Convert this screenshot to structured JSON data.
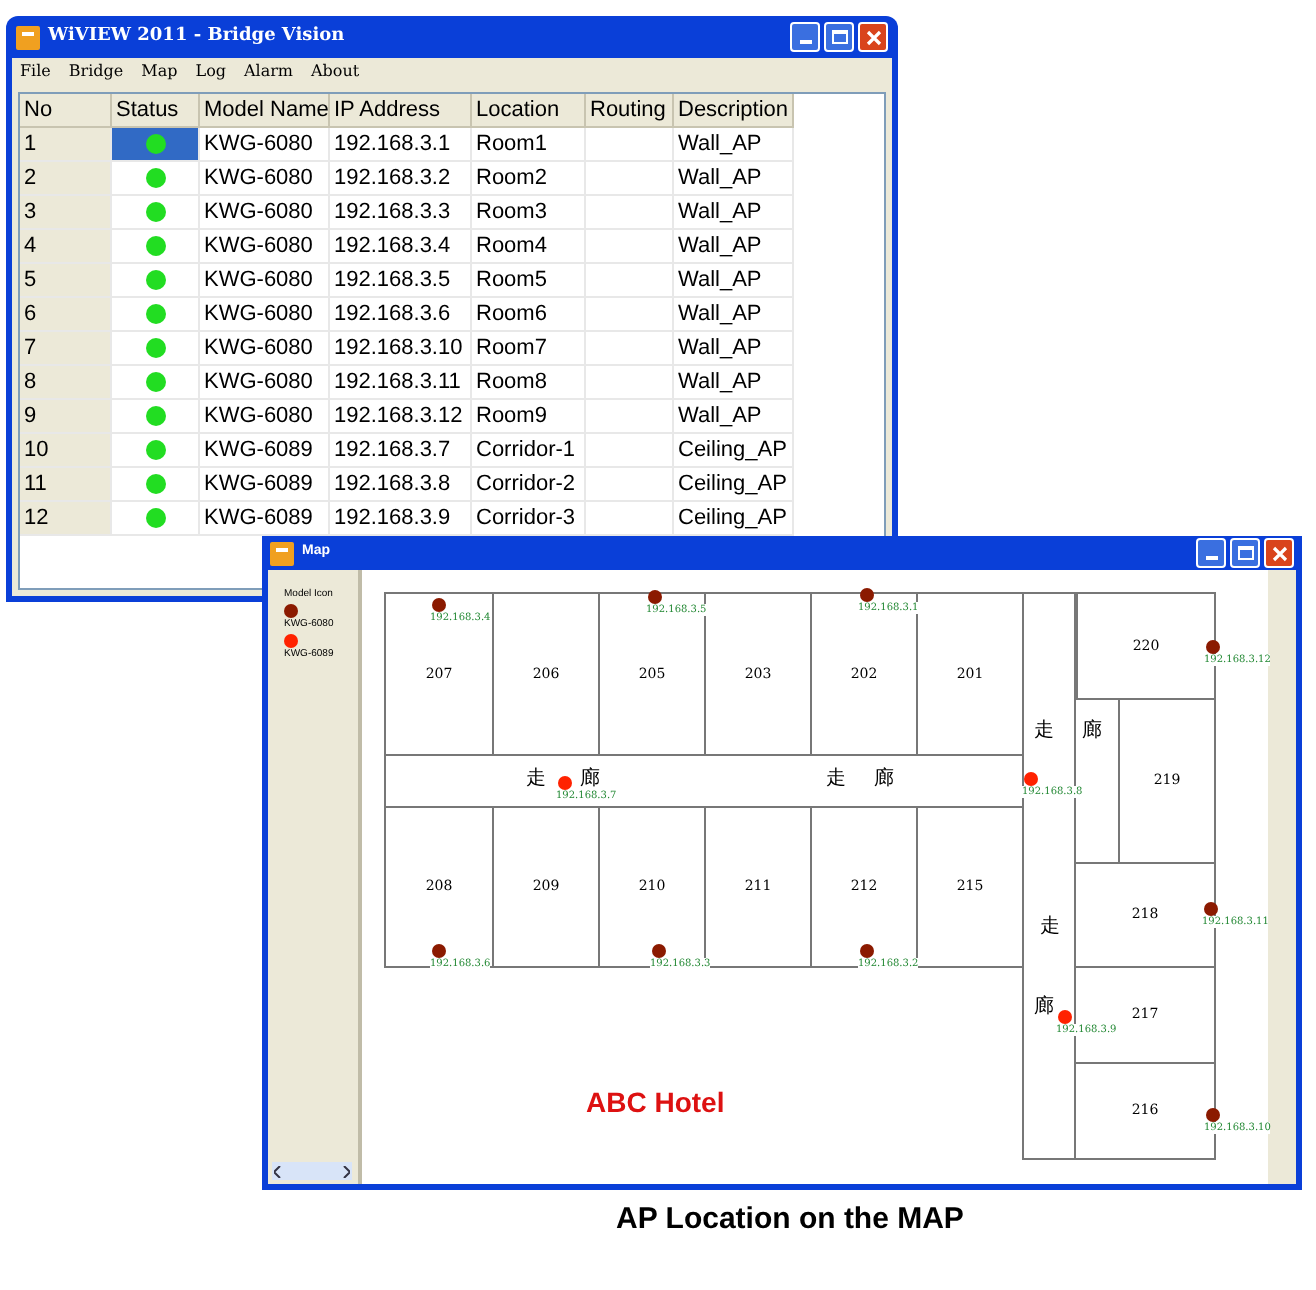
{
  "main_window": {
    "title": "WiVIEW 2011 - Bridge Vision",
    "menu": [
      "File",
      "Bridge",
      "Map",
      "Log",
      "Alarm",
      "About"
    ],
    "columns": [
      "No",
      "Status",
      "Model Name",
      "IP Address",
      "Location",
      "Routing",
      "Description"
    ],
    "rows": [
      {
        "no": "1",
        "online": true,
        "selected": true,
        "model": "KWG-6080",
        "ip": "192.168.3.1",
        "location": "Room1",
        "description": "Wall_AP"
      },
      {
        "no": "2",
        "online": true,
        "selected": false,
        "model": "KWG-6080",
        "ip": "192.168.3.2",
        "location": "Room2",
        "description": "Wall_AP"
      },
      {
        "no": "3",
        "online": true,
        "selected": false,
        "model": "KWG-6080",
        "ip": "192.168.3.3",
        "location": "Room3",
        "description": "Wall_AP"
      },
      {
        "no": "4",
        "online": true,
        "selected": false,
        "model": "KWG-6080",
        "ip": "192.168.3.4",
        "location": "Room4",
        "description": "Wall_AP"
      },
      {
        "no": "5",
        "online": true,
        "selected": false,
        "model": "KWG-6080",
        "ip": "192.168.3.5",
        "location": "Room5",
        "description": "Wall_AP"
      },
      {
        "no": "6",
        "online": true,
        "selected": false,
        "model": "KWG-6080",
        "ip": "192.168.3.6",
        "location": "Room6",
        "description": "Wall_AP"
      },
      {
        "no": "7",
        "online": true,
        "selected": false,
        "model": "KWG-6080",
        "ip": "192.168.3.10",
        "location": "Room7",
        "description": "Wall_AP"
      },
      {
        "no": "8",
        "online": true,
        "selected": false,
        "model": "KWG-6080",
        "ip": "192.168.3.11",
        "location": "Room8",
        "description": "Wall_AP"
      },
      {
        "no": "9",
        "online": true,
        "selected": false,
        "model": "KWG-6080",
        "ip": "192.168.3.12",
        "location": "Room9",
        "description": "Wall_AP"
      },
      {
        "no": "10",
        "online": true,
        "selected": false,
        "model": "KWG-6089",
        "ip": "192.168.3.7",
        "location": "Corridor-1",
        "description": "Ceiling_AP"
      },
      {
        "no": "11",
        "online": true,
        "selected": false,
        "model": "KWG-6089",
        "ip": "192.168.3.8",
        "location": "Corridor-2",
        "description": "Ceiling_AP"
      },
      {
        "no": "12",
        "online": true,
        "selected": false,
        "model": "KWG-6089",
        "ip": "192.168.3.9",
        "location": "Corridor-3",
        "description": "Ceiling_AP"
      }
    ]
  },
  "map_window": {
    "title": "Map",
    "legend": {
      "title": "Model Icon",
      "models": [
        {
          "name": "KWG-6080",
          "color": "#8b1a00"
        },
        {
          "name": "KWG-6089",
          "color": "#ff2200"
        }
      ]
    },
    "rooms": [
      "207",
      "206",
      "205",
      "203",
      "202",
      "201",
      "220",
      "219",
      "208",
      "209",
      "210",
      "211",
      "212",
      "215",
      "218",
      "217",
      "216"
    ],
    "corridor_labels": [
      "走",
      "廊",
      "走",
      "廊",
      "走",
      "廊",
      "走",
      "廊"
    ],
    "pins": [
      {
        "ip": "192.168.3.4",
        "color": "#8b1a00"
      },
      {
        "ip": "192.168.3.5",
        "color": "#8b1a00"
      },
      {
        "ip": "192.168.3.1",
        "color": "#8b1a00"
      },
      {
        "ip": "192.168.3.12",
        "color": "#8b1a00"
      },
      {
        "ip": "192.168.3.7",
        "color": "#ff2200"
      },
      {
        "ip": "192.168.3.8",
        "color": "#ff2200"
      },
      {
        "ip": "192.168.3.6",
        "color": "#8b1a00"
      },
      {
        "ip": "192.168.3.3",
        "color": "#8b1a00"
      },
      {
        "ip": "192.168.3.2",
        "color": "#8b1a00"
      },
      {
        "ip": "192.168.3.11",
        "color": "#8b1a00"
      },
      {
        "ip": "192.168.3.9",
        "color": "#ff2200"
      },
      {
        "ip": "192.168.3.10",
        "color": "#8b1a00"
      }
    ],
    "hotel_name": "ABC Hotel"
  },
  "caption": "AP Location on the MAP"
}
